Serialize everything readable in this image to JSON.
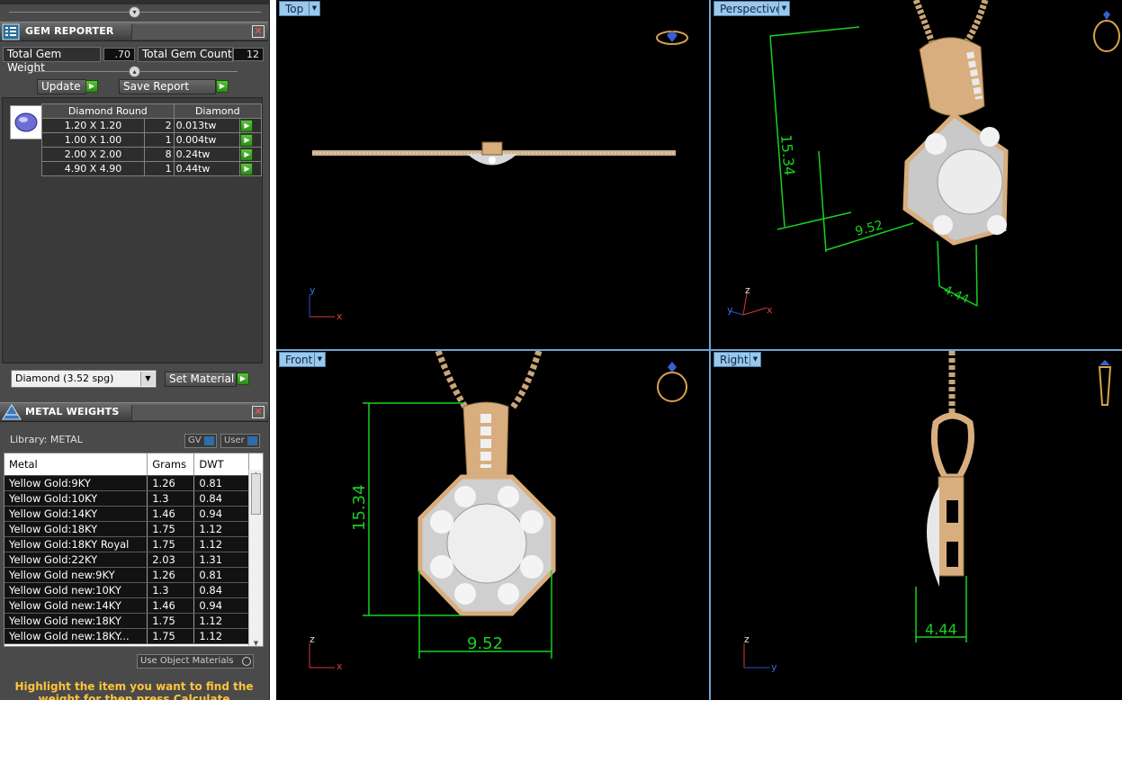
{
  "gem_reporter": {
    "title": "GEM REPORTER",
    "total_gem_weight_label": "Total Gem Weight",
    "total_gem_weight": ".70",
    "total_gem_count_label": "Total Gem Count",
    "total_gem_count": "12",
    "update_label": "Update",
    "save_report_label": "Save Report",
    "header": {
      "shape": "Diamond Round",
      "material": "Diamond"
    },
    "rows": [
      {
        "size": "1.20 X 1.20",
        "count": "2",
        "weight": "0.013tw"
      },
      {
        "size": "1.00 X 1.00",
        "count": "1",
        "weight": "0.004tw"
      },
      {
        "size": "2.00 X 2.00",
        "count": "8",
        "weight": "0.24tw"
      },
      {
        "size": "4.90 X 4.90",
        "count": "1",
        "weight": "0.44tw"
      }
    ],
    "material_select": "Diamond      (3.52 spg)",
    "set_material_label": "Set Material"
  },
  "metal_weights": {
    "title": "METAL WEIGHTS",
    "library_label": "Library: METAL",
    "gv_label": "GV",
    "user_label": "User",
    "columns": [
      "Metal",
      "Grams",
      "DWT"
    ],
    "rows": [
      {
        "metal": "Yellow Gold:9KY",
        "grams": "1.26",
        "dwt": "0.81"
      },
      {
        "metal": "Yellow Gold:10KY",
        "grams": "1.3",
        "dwt": "0.84"
      },
      {
        "metal": "Yellow Gold:14KY",
        "grams": "1.46",
        "dwt": "0.94"
      },
      {
        "metal": "Yellow Gold:18KY",
        "grams": "1.75",
        "dwt": "1.12"
      },
      {
        "metal": "Yellow Gold:18KY Royal",
        "grams": "1.75",
        "dwt": "1.12"
      },
      {
        "metal": "Yellow Gold:22KY",
        "grams": "2.03",
        "dwt": "1.31"
      },
      {
        "metal": "Yellow Gold new:9KY",
        "grams": "1.26",
        "dwt": "0.81"
      },
      {
        "metal": "Yellow Gold new:10KY",
        "grams": "1.3",
        "dwt": "0.84"
      },
      {
        "metal": "Yellow Gold new:14KY",
        "grams": "1.46",
        "dwt": "0.94"
      },
      {
        "metal": "Yellow Gold new:18KY",
        "grams": "1.75",
        "dwt": "1.12"
      },
      {
        "metal": "Yellow Gold new:18KY...",
        "grams": "1.75",
        "dwt": "1.12"
      }
    ],
    "use_object_materials_label": "Use Object Materials",
    "hint": "Highlight the item you want to find the weight for then press Calculate"
  },
  "viewports": {
    "top": {
      "label": "Top",
      "axis_h": "x",
      "axis_v": "y"
    },
    "perspective": {
      "label": "Perspective",
      "dim_height": "15.34",
      "dim_width": "9.52",
      "dim_depth": "4.44",
      "axis_v": "z",
      "axis_h": "x",
      "axis_d": "y"
    },
    "front": {
      "label": "Front",
      "dim_height": "15.34",
      "dim_width": "9.52",
      "axis_v": "z",
      "axis_h": "x"
    },
    "right": {
      "label": "Right",
      "dim_depth": "4.44",
      "axis_v": "z",
      "axis_h": "y"
    }
  },
  "colors": {
    "panel_bg": "#4a4a4a",
    "viewport_bg": "#000000",
    "viewport_label": "#9bc7ea",
    "dimension_green": "#19d11f",
    "gold": "#d9ae7e",
    "hint_text": "#ffc43a"
  },
  "icons": [
    "gem-reporter-icon",
    "metal-weights-icon",
    "close-icon",
    "play-arrow-icon",
    "dropdown-arrow-icon",
    "ring-view-icon",
    "diamond-icon"
  ]
}
